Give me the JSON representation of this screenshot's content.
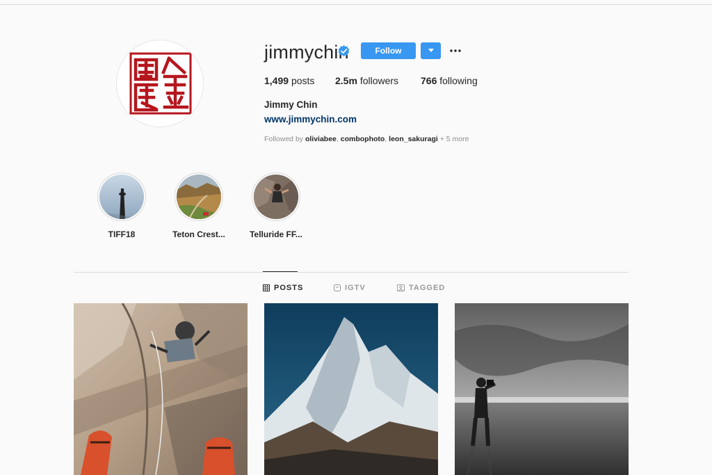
{
  "profile": {
    "username": "jimmychin",
    "follow_label": "Follow",
    "full_name": "Jimmy Chin",
    "website": "www.jimmychin.com",
    "verified": true
  },
  "stats": {
    "posts_count": "1,499",
    "posts_label": "posts",
    "followers_count": "2.5m",
    "followers_label": "followers",
    "following_count": "766",
    "following_label": "following"
  },
  "followed_by": {
    "prefix": "Followed by",
    "names": [
      "oliviabee",
      "combophoto",
      "leon_sakuragi"
    ],
    "more": "+ 5 more"
  },
  "highlights": [
    {
      "label": "TIFF18"
    },
    {
      "label": "Teton Crest..."
    },
    {
      "label": "Telluride FF..."
    }
  ],
  "tabs": [
    {
      "label": "POSTS",
      "icon": "grid-icon",
      "active": true
    },
    {
      "label": "IGTV",
      "icon": "igtv-icon",
      "active": false
    },
    {
      "label": "TAGGED",
      "icon": "tagged-icon",
      "active": false
    }
  ],
  "colors": {
    "accent": "#3897f0",
    "link": "#003569",
    "seal_red": "#b5161d"
  }
}
